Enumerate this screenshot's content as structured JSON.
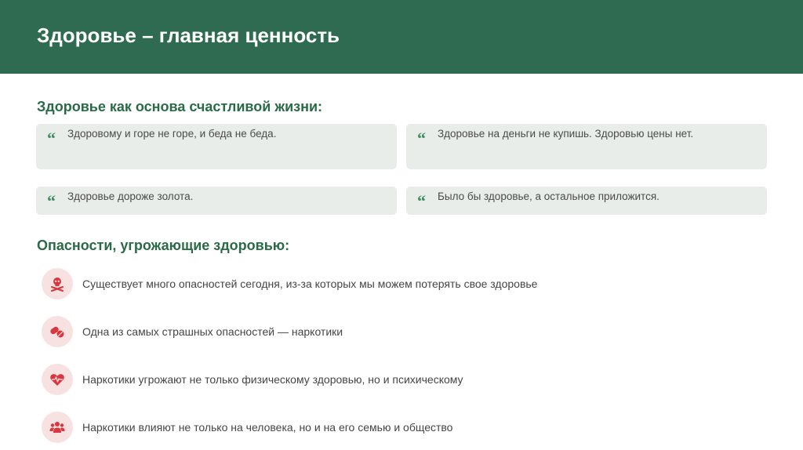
{
  "header": {
    "title": "Здоровье – главная ценность"
  },
  "section1": {
    "title": "Здоровье как основа счастливой жизни:",
    "quote_mark": "“",
    "quotes": [
      "Здоровому и горе не горе, и беда не беда.",
      "Здоровье на деньги не купишь. Здоровью цены нет.",
      "Здоровье дороже золота.",
      "Было бы здоровье, а остальное приложится."
    ]
  },
  "section2": {
    "title": "Опасности, угрожающие здоровью:",
    "items": [
      {
        "icon": "skull-crossbones-icon",
        "text": "Существует много опасностей сегодня, из-за которых мы можем потерять свое здоровье"
      },
      {
        "icon": "pills-icon",
        "text": "Одна из самых страшных опасностей — наркотики"
      },
      {
        "icon": "heart-pulse-icon",
        "text": "Наркотики угрожают не только физическому здоровью, но и психическому"
      },
      {
        "icon": "people-group-icon",
        "text": "Наркотики влияют не только на человека, но и на его семью и общество"
      }
    ]
  },
  "colors": {
    "header_bg": "#2e6b50",
    "accent_green": "#2a6a46",
    "card_bg": "#e9edea",
    "danger_red": "#d9363e",
    "danger_circle": "#f8e1e1"
  }
}
